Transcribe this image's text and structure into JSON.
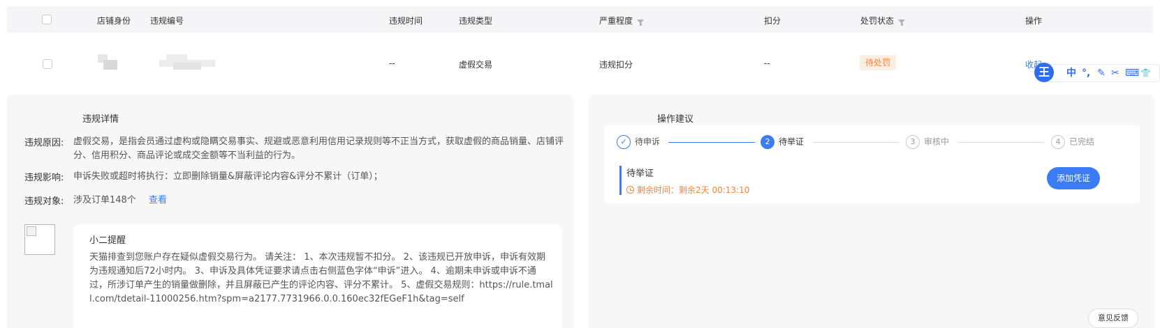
{
  "table": {
    "headers": {
      "store_identity": "店铺身份",
      "violation_id": "违规编号",
      "violation_time": "违规时间",
      "violation_type": "违规类型",
      "severity": "严重程度",
      "deduction": "扣分",
      "penalty_status": "处罚状态",
      "action": "操作"
    },
    "row": {
      "violation_time": "--",
      "violation_type": "虚假交易",
      "severity": "违规扣分",
      "deduction": "--",
      "penalty_status": "待处罚",
      "action": "收起"
    }
  },
  "ime_toolbar": {
    "logo": "王",
    "buttons": [
      "中",
      "°,",
      "✎",
      "✂",
      "⌨",
      "👕"
    ]
  },
  "details": {
    "title": "违规详情",
    "reason_label": "违规原因:",
    "reason_text": "虚假交易，是指会员通过虚构或隐瞒交易事实、规避或恶意利用信用记录规则等不正当方式，获取虚假的商品销量、店铺评分、信用积分、商品评论或成交金额等不当利益的行为。",
    "impact_label": "违规影响:",
    "impact_text": "申诉失败或超时将执行：立即删除销量&屏蔽评论内容&评分不累计（订单）；",
    "target_label": "违规对象:",
    "target_text": "涉及订单148个",
    "target_link": "查看"
  },
  "reminder": {
    "title": "小二提醒",
    "text": "天猫排查到您账户存在疑似虚假交易行为。 请关注： 1、本次违规暂不扣分。 2、该违规已开放申诉，申诉有效期为违规通知后72小时内。 3、申诉及具体凭证要求请点击右侧蓝色字体“申诉”进入。 4、逾期未申诉或申诉不通过，所涉订单产生的销量做删除，并且屏蔽已产生的评论内容、评分不累计。 5、虚假交易规则：https://rule.tmall.com/tdetail-11000256.htm?spm=a2177.7731966.0.0.160ec32fEGeF1h&tag=self"
  },
  "suggestion": {
    "title": "操作建议",
    "steps": [
      {
        "num": "✓",
        "label": "待申诉",
        "state": "done"
      },
      {
        "num": "2",
        "label": "待举证",
        "state": "active"
      },
      {
        "num": "3",
        "label": "审核中",
        "state": "todo"
      },
      {
        "num": "4",
        "label": "已完结",
        "state": "todo"
      }
    ],
    "current_title": "待举证",
    "countdown": "剩余时间：剩余2天 00:13:10",
    "add_button": "添加凭证"
  },
  "feedback_button": "意见反馈",
  "colors": {
    "accent": "#3b7cf4",
    "warning": "#f5853b",
    "badge_bg": "#fdeee3"
  }
}
